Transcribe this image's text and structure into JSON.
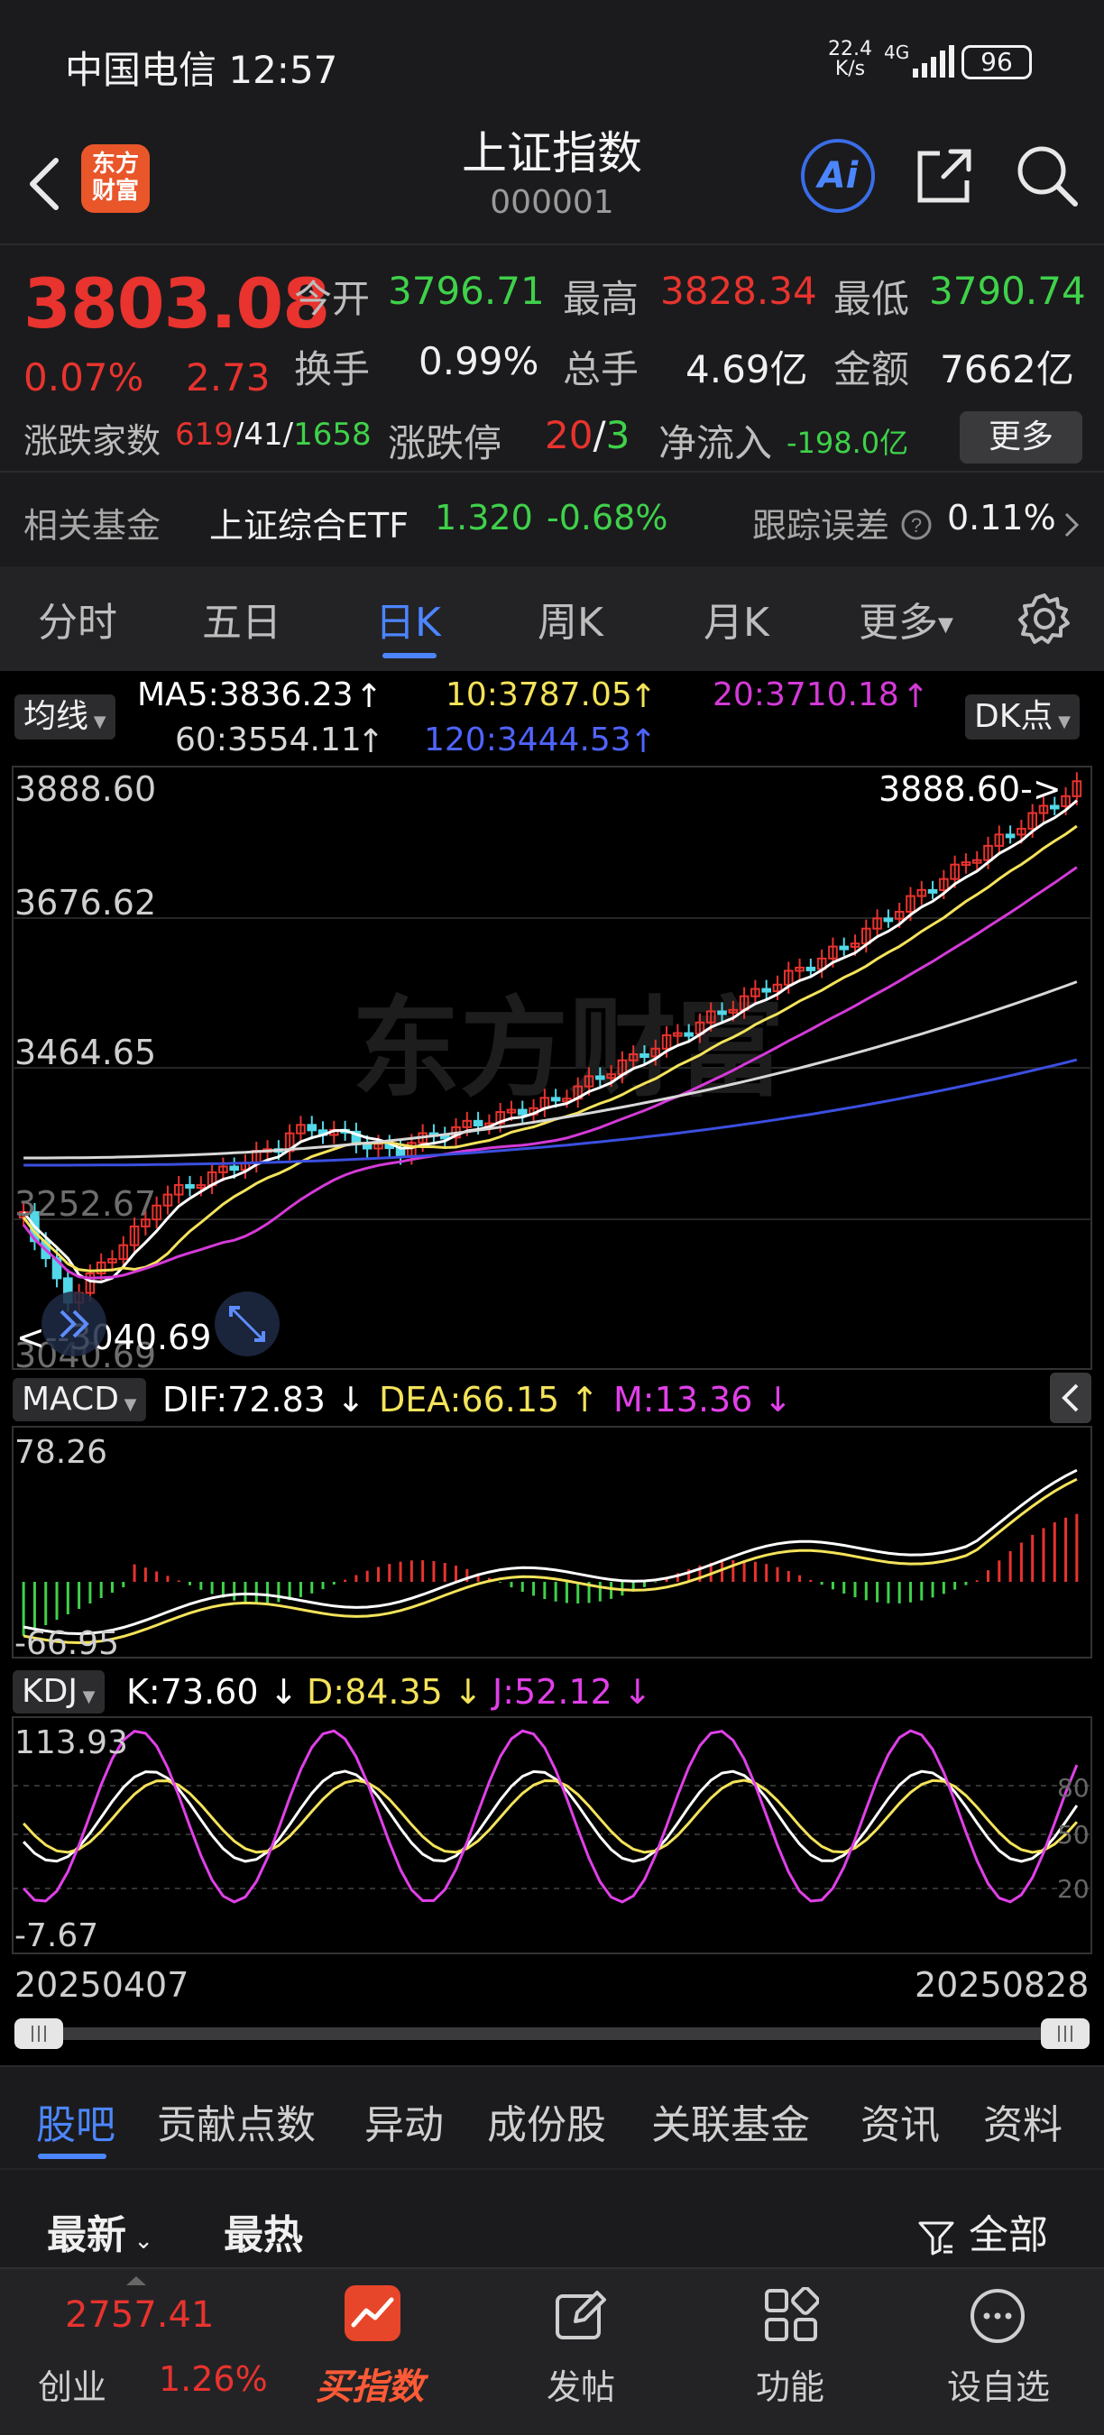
{
  "status": {
    "carrier_time": "中国电信 12:57",
    "net_speed_top": "22.4",
    "net_speed_bottom": "K/s",
    "net_type": "4G",
    "battery": "96"
  },
  "nav": {
    "logo_line1": "东方",
    "logo_line2": "财富",
    "title": "上证指数",
    "code": "000001",
    "ai_label": "Ai"
  },
  "quote": {
    "price": "3803.08",
    "pct": "0.07%",
    "change": "2.73",
    "open_label": "今开",
    "open": "3796.71",
    "high_label": "最高",
    "high": "3828.34",
    "low_label": "最低",
    "low": "3790.74",
    "turnover_label": "换手",
    "turnover": "0.99%",
    "volume_label": "总手",
    "volume": "4.69亿",
    "amount_label": "金额",
    "amount": "7662亿",
    "breadth_label": "涨跌家数",
    "breadth_up": "619",
    "breadth_flat": "41",
    "breadth_down": "1658",
    "limit_label": "涨跌停",
    "limit_up": "20",
    "limit_down": "3",
    "inflow_label": "净流入",
    "inflow": "-198.0亿",
    "more": "更多"
  },
  "fund": {
    "label": "相关基金",
    "name": "上证综合ETF",
    "price": "1.320",
    "pct": "-0.68%",
    "tracking_label": "跟踪误差",
    "tracking": "0.11%"
  },
  "tabs": [
    "分时",
    "五日",
    "日K",
    "周K",
    "月K",
    "更多"
  ],
  "active_tab": "日K",
  "ma": {
    "selector": "均线",
    "ma5": "MA5:3836.23",
    "ma10": "10:3787.05",
    "ma20": "20:3710.18",
    "ma60": "60:3554.11",
    "ma120": "120:3444.53",
    "dk": "DK点",
    "colors": {
      "ma5": "#ffffff",
      "ma10": "#f4e35a",
      "ma20": "#d43ad8",
      "ma60": "#d8d8d8",
      "ma120": "#3b4fe0"
    }
  },
  "price_axis": {
    "top": "3888.60",
    "l2": "3676.62",
    "l3": "3464.65",
    "l4": "3252.67",
    "bottom": "3040.69"
  },
  "markers": {
    "high": "3888.60->",
    "low": "<--3040.69"
  },
  "macd": {
    "selector": "MACD",
    "dif": "DIF:72.83",
    "dea": "DEA:66.15",
    "m": "M:13.36",
    "top": "78.26",
    "bottom": "-66.95"
  },
  "kdj": {
    "selector": "KDJ",
    "k": "K:73.60",
    "d": "D:84.35",
    "j": "J:52.12",
    "top": "113.93",
    "bottom": "-7.67",
    "r80": "80",
    "r50": "50",
    "r20": "20"
  },
  "dates": {
    "start": "20250407",
    "end": "20250828"
  },
  "watermark": "东方财富",
  "bottom_tabs": [
    "股吧",
    "贡献点数",
    "异动",
    "成份股",
    "关联基金",
    "资讯",
    "资料"
  ],
  "sort": {
    "latest": "最新",
    "hottest": "最热",
    "filter": "全部"
  },
  "dock": {
    "index_value": "2757.41",
    "index_name": "创业",
    "index_pct": "1.26%",
    "buy": "买指数",
    "post": "发帖",
    "func": "功能",
    "watch": "设自选"
  }
}
